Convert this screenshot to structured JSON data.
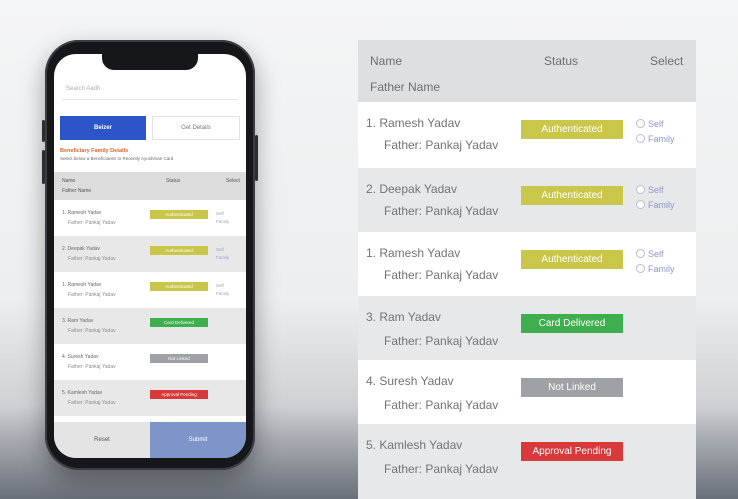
{
  "colors": {
    "authenticated": "#c9c64a",
    "card_delivered": "#3fae4e",
    "not_linked": "#9ea1a5",
    "approval_pending": "#d8393b",
    "primary": "#2b55c9"
  },
  "phone": {
    "search_placeholder": "Search Aadh",
    "tab_active": "Beizer",
    "tab_inactive": "Get Details",
    "section_title": "Beneficiary Family Details",
    "section_subtitle": "Select below a Beneficiaries to Recently Ayushman Card",
    "header": {
      "name": "Name",
      "father": "Father Name",
      "status": "Status",
      "select": "Select"
    },
    "rows": [
      {
        "name": "1. Ramesh Yadav",
        "father": "Father: Pankaj Yadav",
        "status": "Authenticated",
        "tone": "authenticated",
        "options": [
          "Self",
          "Family"
        ]
      },
      {
        "name": "2. Deepak Yadav",
        "father": "Father: Pankaj Yadav",
        "status": "Authenticated",
        "tone": "authenticated",
        "options": [
          "Self",
          "Family"
        ]
      },
      {
        "name": "1. Ramesh Yadav",
        "father": "Father: Pankaj Yadav",
        "status": "Authenticated",
        "tone": "authenticated",
        "options": [
          "Self",
          "Family"
        ]
      },
      {
        "name": "3. Ram Yadav",
        "father": "Father: Pankaj Yadav",
        "status": "Card Delivered",
        "tone": "card_delivered",
        "options": []
      },
      {
        "name": "4. Suresh Yadav",
        "father": "Father: Pankaj Yadav",
        "status": "Not Linked",
        "tone": "not_linked",
        "options": []
      },
      {
        "name": "5. Kamlesh Yadav",
        "father": "Father: Pankaj Yadav",
        "status": "Approval Pending",
        "tone": "approval_pending",
        "options": []
      }
    ],
    "reset_label": "Reset",
    "submit_label": "Submit"
  },
  "panel": {
    "header": {
      "name": "Name",
      "father": "Father Name",
      "status": "Status",
      "select": "Select"
    },
    "rows": [
      {
        "name": "1. Ramesh Yadav",
        "father": "Father: Pankaj Yadav",
        "status": "Authenticated",
        "tone": "authenticated",
        "options": [
          "Self",
          "Family"
        ]
      },
      {
        "name": "2. Deepak Yadav",
        "father": "Father: Pankaj Yadav",
        "status": "Authenticated",
        "tone": "authenticated",
        "options": [
          "Self",
          "Family"
        ]
      },
      {
        "name": "1. Ramesh Yadav",
        "father": "Father: Pankaj Yadav",
        "status": "Authenticated",
        "tone": "authenticated",
        "options": [
          "Self",
          "Family"
        ]
      },
      {
        "name": "3. Ram Yadav",
        "father": "Father: Pankaj Yadav",
        "status": "Card Delivered",
        "tone": "card_delivered",
        "options": []
      },
      {
        "name": "4. Suresh Yadav",
        "father": "Father: Pankaj Yadav",
        "status": "Not Linked",
        "tone": "not_linked",
        "options": []
      },
      {
        "name": "5. Kamlesh Yadav",
        "father": "Father: Pankaj Yadav",
        "status": "Approval Pending",
        "tone": "approval_pending",
        "options": []
      }
    ]
  }
}
